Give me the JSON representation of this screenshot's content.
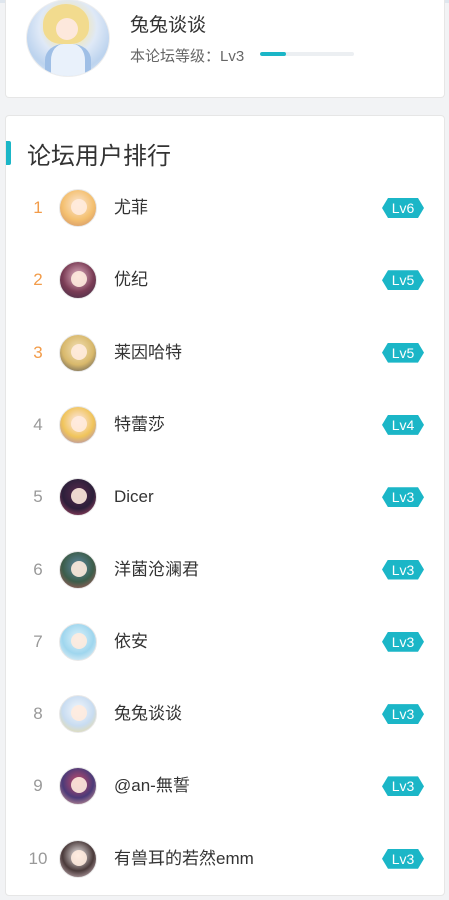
{
  "user": {
    "name": "兔兔谈谈",
    "level_label": "本论坛等级：Lv3",
    "level_progress": 0.28
  },
  "ranking": {
    "title": "论坛用户排行",
    "items": [
      {
        "rank": "1",
        "name": "尤菲",
        "level": "Lv6",
        "avatar_colors": [
          "#fbe7d6",
          "#f4c070",
          "#c98a66"
        ]
      },
      {
        "rank": "2",
        "name": "优纪",
        "level": "Lv5",
        "avatar_colors": [
          "#e6b7c8",
          "#7a3c55",
          "#3b2c45"
        ]
      },
      {
        "rank": "3",
        "name": "莱因哈特",
        "level": "Lv5",
        "avatar_colors": [
          "#f3e1b8",
          "#d8b86b",
          "#4a4a52"
        ]
      },
      {
        "rank": "4",
        "name": "特蕾莎",
        "level": "Lv4",
        "avatar_colors": [
          "#fde9ef",
          "#f0c45a",
          "#9b7fd0"
        ]
      },
      {
        "rank": "5",
        "name": "Dicer",
        "level": "Lv3",
        "avatar_colors": [
          "#5a2a4d",
          "#2c1f3a",
          "#c24d6d"
        ]
      },
      {
        "rank": "6",
        "name": "洋菌沧澜君",
        "level": "Lv3",
        "avatar_colors": [
          "#5f8aa8",
          "#3c5d4a",
          "#c05c5c"
        ]
      },
      {
        "rank": "7",
        "name": "依安",
        "level": "Lv3",
        "avatar_colors": [
          "#dff3fb",
          "#9fd6ee",
          "#f7f7f7"
        ]
      },
      {
        "rank": "8",
        "name": "兔兔谈谈",
        "level": "Lv3",
        "avatar_colors": [
          "#f4f8fc",
          "#c8dcf1",
          "#f2db8e"
        ]
      },
      {
        "rank": "9",
        "name": "@an-無誓",
        "level": "Lv3",
        "avatar_colors": [
          "#c84a6a",
          "#4b3a78",
          "#f0b0a0"
        ]
      },
      {
        "rank": "10",
        "name": "有兽耳的若然emm",
        "level": "Lv3",
        "avatar_colors": [
          "#f7f3f3",
          "#4a3a3a",
          "#e8d0d8"
        ]
      }
    ]
  },
  "colors": {
    "accent": "#1bb6c7",
    "top_rank": "#f29c4a",
    "rank": "#999999"
  }
}
